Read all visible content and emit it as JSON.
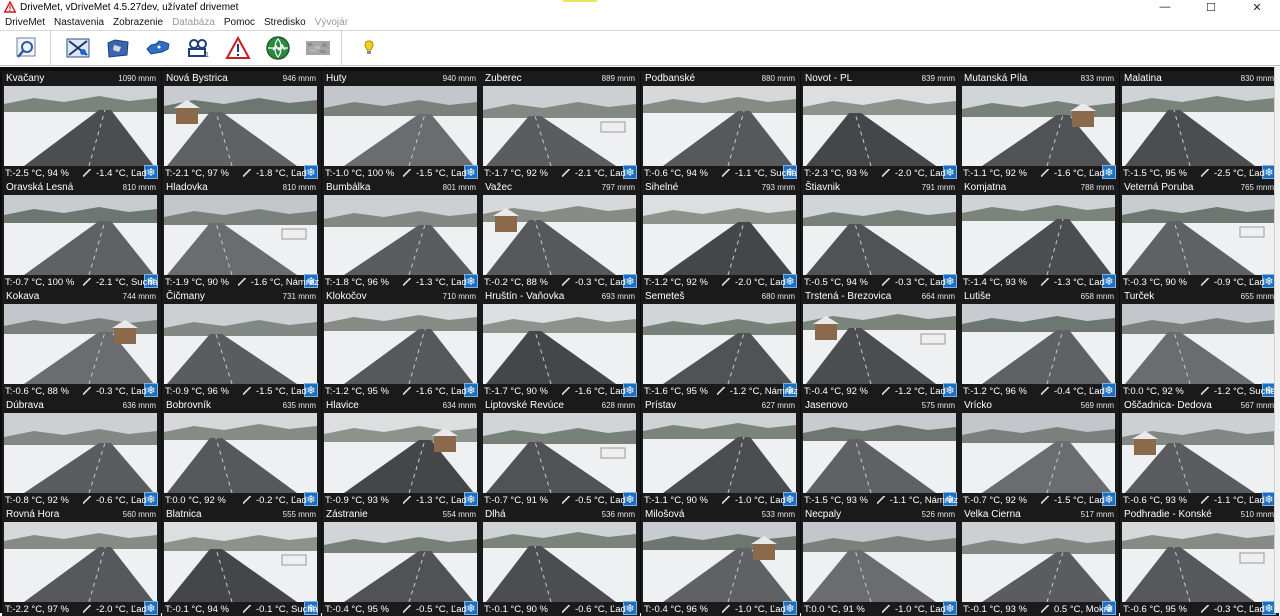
{
  "window": {
    "title": "DriveMet, vDriveMet 4.5.27dev, užívateľ drivemet",
    "minimize": "—",
    "maximize": "☐",
    "close": "✕"
  },
  "menu": [
    {
      "label": "DriveMet",
      "enabled": true
    },
    {
      "label": "Nastavenia",
      "enabled": true
    },
    {
      "label": "Zobrazenie",
      "enabled": true
    },
    {
      "label": "Databáza",
      "enabled": false
    },
    {
      "label": "Pomoc",
      "enabled": true
    },
    {
      "label": "Stredisko",
      "enabled": true
    },
    {
      "label": "Vývojár",
      "enabled": false
    }
  ],
  "toolbar": [
    {
      "name": "search-map-icon"
    },
    {
      "name": "tools-map-icon"
    },
    {
      "name": "map-view-icon"
    },
    {
      "name": "slovakia-map-icon"
    },
    {
      "name": "cameras-icon"
    },
    {
      "name": "warning-icon"
    },
    {
      "name": "globe-icon"
    },
    {
      "name": "texture-icon"
    },
    {
      "name": "help-bulb-icon"
    }
  ],
  "cameras": [
    {
      "name": "Kvačany",
      "alt": "1090 mnm",
      "air": "T:-2.5 °C, 94 %",
      "road": "-1.4 °C, Ľad"
    },
    {
      "name": "Nová Bystrica",
      "alt": "946 mnm",
      "air": "T:-2.1 °C, 97 %",
      "road": "-1.8 °C, Ľad"
    },
    {
      "name": "Huty",
      "alt": "940 mnm",
      "air": "T:-1.0 °C, 100 %",
      "road": "-1.5 °C, Ľad"
    },
    {
      "name": "Zuberec",
      "alt": "889 mnm",
      "air": "T:-1.7 °C, 92 %",
      "road": "-2.1 °C, Ľad"
    },
    {
      "name": "Podbanské",
      "alt": "880 mnm",
      "air": "T:-0.6 °C, 94 %",
      "road": "-1.1 °C, Suchá"
    },
    {
      "name": "Novot - PL",
      "alt": "839 mnm",
      "air": "T:-2.3 °C, 93 %",
      "road": "-2.0 °C, Ľad"
    },
    {
      "name": "Mutanská Píla",
      "alt": "833 mnm",
      "air": "T:-1.1 °C, 92 %",
      "road": "-1.6 °C, Ľad"
    },
    {
      "name": "Malatina",
      "alt": "830 mnm",
      "air": "T:-1.5 °C, 95 %",
      "road": "-2.5 °C, Ľad"
    },
    {
      "name": "Oravská Lesná",
      "alt": "810 mnm",
      "air": "T:-0.7 °C, 100 %",
      "road": "-2.1 °C, Suchá"
    },
    {
      "name": "Hladovka",
      "alt": "810 mnm",
      "air": "T:-1.9 °C, 90 %",
      "road": "-1.6 °C, Námraz"
    },
    {
      "name": "Bumbálka",
      "alt": "801 mnm",
      "air": "T:-1.8 °C, 96 %",
      "road": "-1.3 °C, Ľad"
    },
    {
      "name": "Važec",
      "alt": "797 mnm",
      "air": "T:-0.2 °C, 88 %",
      "road": "-0.3 °C, Ľad"
    },
    {
      "name": "Sihelné",
      "alt": "793 mnm",
      "air": "T:-1.2 °C, 92 %",
      "road": "-2.0 °C, Ľad"
    },
    {
      "name": "Štiavnik",
      "alt": "791 mnm",
      "air": "T:-0.5 °C, 94 %",
      "road": "-0.3 °C, Ľad"
    },
    {
      "name": "Komjatna",
      "alt": "788 mnm",
      "air": "T:-1.4 °C, 93 %",
      "road": "-1.3 °C, Ľad"
    },
    {
      "name": "Veterná Poruba",
      "alt": "765 mnm",
      "air": "T:-0.3 °C, 90 %",
      "road": "-0.9 °C, Ľad"
    },
    {
      "name": "Kokava",
      "alt": "744 mnm",
      "air": "T:-0.6 °C, 88 %",
      "road": "-0.3 °C, Ľad"
    },
    {
      "name": "Čičmany",
      "alt": "731 mnm",
      "air": "T:-0.9 °C, 96 %",
      "road": "-1.5 °C, Ľad"
    },
    {
      "name": "Klokočov",
      "alt": "710 mnm",
      "air": "T:-1.2 °C, 95 %",
      "road": "-1.6 °C, Ľad"
    },
    {
      "name": "Hruštín - Vaňovka",
      "alt": "693 mnm",
      "air": "T:-1.7 °C, 90 %",
      "road": "-1.6 °C, Ľad"
    },
    {
      "name": "Semeteš",
      "alt": "680 mnm",
      "air": "T:-1.6 °C, 95 %",
      "road": "-1.2 °C, Námraz"
    },
    {
      "name": "Trstená - Brezovica",
      "alt": "664 mnm",
      "air": "T:-0.4 °C, 92 %",
      "road": "-1.2 °C, Ľad"
    },
    {
      "name": "Lutiše",
      "alt": "658 mnm",
      "air": "T:-1.2 °C, 96 %",
      "road": "-0.4 °C, Ľad"
    },
    {
      "name": "Turček",
      "alt": "655 mnm",
      "air": "T:0.0 °C, 92 %",
      "road": "-1.2 °C, Suchá"
    },
    {
      "name": "Dúbrava",
      "alt": "636 mnm",
      "air": "T:-0.8 °C, 92 %",
      "road": "-0.6 °C, Ľad"
    },
    {
      "name": "Bobrovník",
      "alt": "635 mnm",
      "air": "T:0.0 °C, 92 %",
      "road": "-0.2 °C, Ľad"
    },
    {
      "name": "Hlavice",
      "alt": "634 mnm",
      "air": "T:-0.9 °C, 93 %",
      "road": "-1.3 °C, Ľad"
    },
    {
      "name": "Liptovské Revúce",
      "alt": "628 mnm",
      "air": "T:-0.7 °C, 91 %",
      "road": "-0.5 °C, Ľad"
    },
    {
      "name": "Prístav",
      "alt": "627 mnm",
      "air": "T:-1.1 °C, 90 %",
      "road": "-1.0 °C, Ľad"
    },
    {
      "name": "Jasenovo",
      "alt": "575 mnm",
      "air": "T:-1.5 °C, 93 %",
      "road": "-1.1 °C, Námraz"
    },
    {
      "name": "Vrícko",
      "alt": "569 mnm",
      "air": "T:-0.7 °C, 92 %",
      "road": "-1.5 °C, Ľad"
    },
    {
      "name": "Oščadnica- Dedova",
      "alt": "567 mnm",
      "air": "T:-0.6 °C, 93 %",
      "road": "-1.1 °C, Ľad"
    },
    {
      "name": "Rovná Hora",
      "alt": "560 mnm",
      "air": "T:-2.2 °C, 97 %",
      "road": "-2.0 °C, Ľad"
    },
    {
      "name": "Blatnica",
      "alt": "555 mnm",
      "air": "T:-0.1 °C, 94 %",
      "road": "-0.1 °C, Suchá"
    },
    {
      "name": "Zástranie",
      "alt": "554 mnm",
      "air": "T:-0.4 °C, 95 %",
      "road": "-0.5 °C, Ľad"
    },
    {
      "name": "Dlhá",
      "alt": "536 mnm",
      "air": "T:-0.1 °C, 90 %",
      "road": "-0.6 °C, Ľad"
    },
    {
      "name": "Milošová",
      "alt": "533 mnm",
      "air": "T:-0.4 °C, 96 %",
      "road": "-1.0 °C, Ľad"
    },
    {
      "name": "Necpaly",
      "alt": "526 mnm",
      "air": "T:0.0 °C, 91 %",
      "road": "-1.0 °C, Ľad"
    },
    {
      "name": "Velka Cierna",
      "alt": "517 mnm",
      "air": "T:-0.1 °C, 93 %",
      "road": "0.5 °C, Mokrá"
    },
    {
      "name": "Podhradie - Konské",
      "alt": "510 mnm",
      "air": "T:-0.6 °C, 95 %",
      "road": "-0.3 °C, Ľad"
    }
  ],
  "colors": {
    "grid_bg": "#0c0c0c",
    "snow_badge": "#1c6fc0",
    "road": "#4a4a4a",
    "snow": "#e9ecef"
  },
  "status_icon": "snowflake-icon"
}
